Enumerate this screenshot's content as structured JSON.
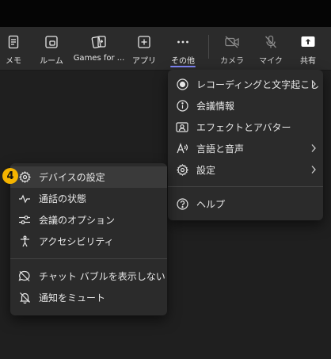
{
  "toolbar": {
    "items": [
      {
        "label": "メモ",
        "icon": "notes-icon"
      },
      {
        "label": "ルーム",
        "icon": "rooms-icon"
      },
      {
        "label": "Games for ...",
        "icon": "games-icon"
      },
      {
        "label": "アプリ",
        "icon": "apps-add-icon"
      },
      {
        "label": "その他",
        "icon": "more-icon",
        "active": true
      },
      {
        "label": "カメラ",
        "icon": "camera-off-icon",
        "disabled": true
      },
      {
        "label": "マイク",
        "icon": "mic-off-icon",
        "disabled": true
      },
      {
        "label": "共有",
        "icon": "share-icon"
      }
    ],
    "accent_color": "#7f85f5"
  },
  "more_menu": {
    "items": [
      {
        "label": "レコーディングと文字起こし",
        "icon": "record-icon",
        "has_submenu": true
      },
      {
        "label": "会議情報",
        "icon": "info-icon"
      },
      {
        "label": "エフェクトとアバター",
        "icon": "effects-icon"
      },
      {
        "label": "言語と音声",
        "icon": "language-icon",
        "has_submenu": true
      },
      {
        "label": "設定",
        "icon": "gear-icon",
        "has_submenu": true
      },
      {
        "label": "ヘルプ",
        "icon": "help-icon"
      }
    ]
  },
  "settings_menu": {
    "items": [
      {
        "label": "デバイスの設定",
        "icon": "gear-icon",
        "highlighted": true
      },
      {
        "label": "通話の状態",
        "icon": "call-health-icon"
      },
      {
        "label": "会議のオプション",
        "icon": "options-icon"
      },
      {
        "label": "アクセシビリティ",
        "icon": "accessibility-icon"
      },
      {
        "label": "チャット バブルを表示しない",
        "icon": "chat-off-icon"
      },
      {
        "label": "通知をミュート",
        "icon": "notifications-off-icon"
      }
    ]
  },
  "step_badge": {
    "text": "4",
    "color": "#f5b400"
  }
}
